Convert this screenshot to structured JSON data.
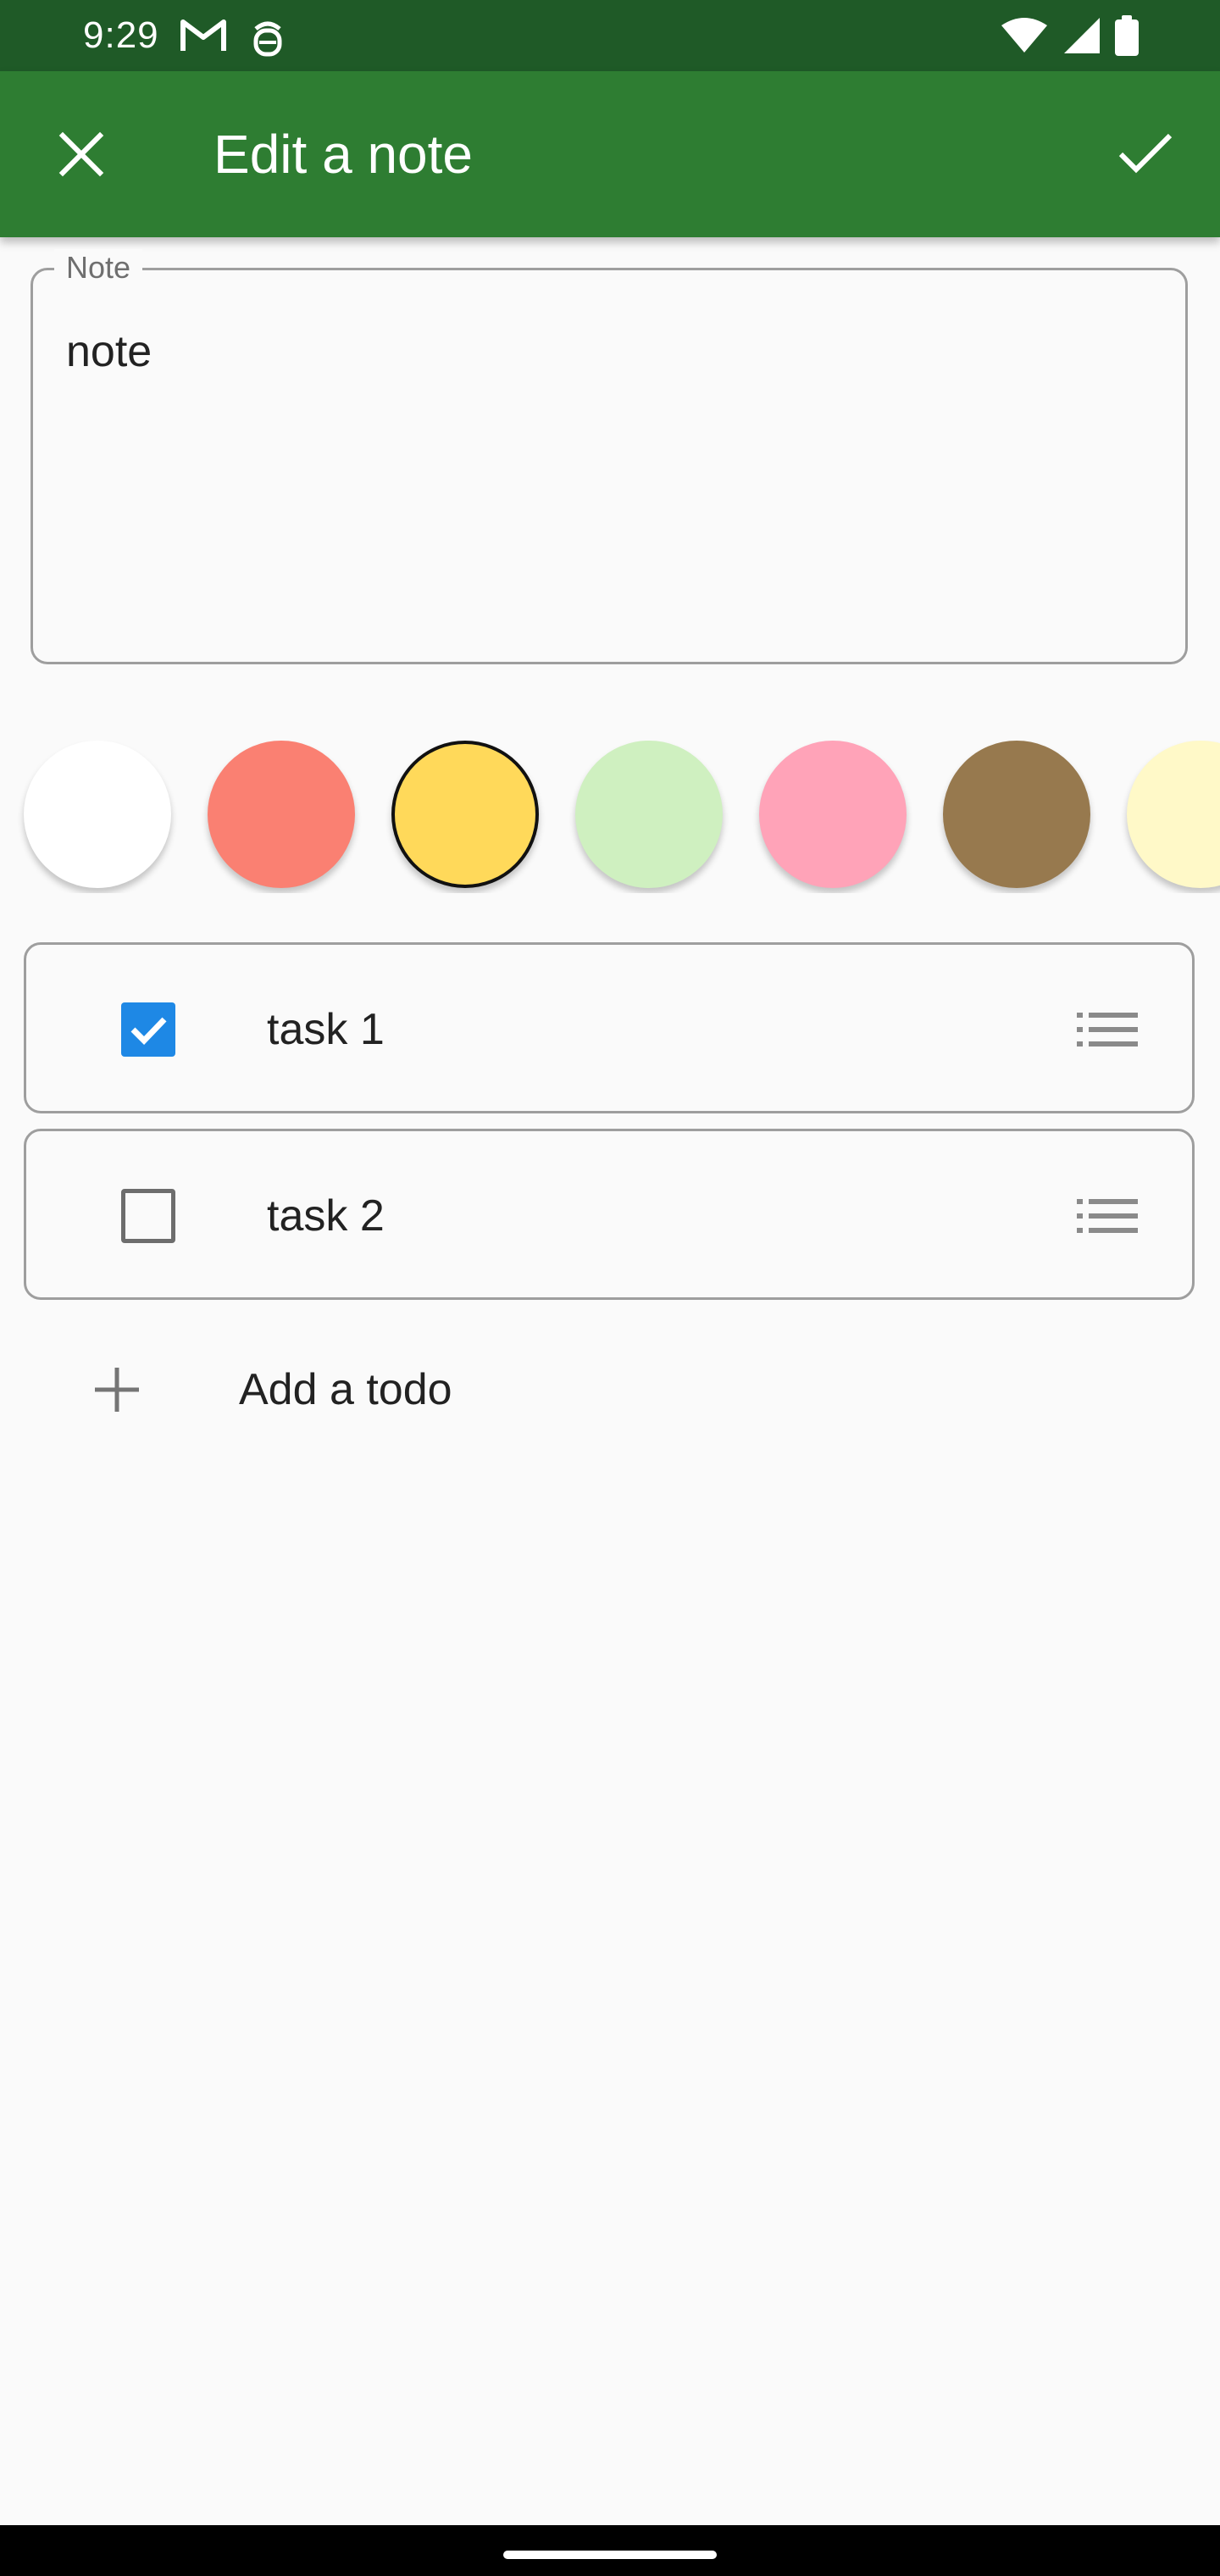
{
  "status_bar": {
    "time": "9:29",
    "left_icons": [
      "gmail-icon",
      "android-debug-icon"
    ],
    "right_icons": [
      "wifi-icon",
      "signal-icon",
      "battery-icon"
    ]
  },
  "app_bar": {
    "title": "Edit a note",
    "close_icon": "close-icon",
    "confirm_icon": "check-icon",
    "background": "#2e7d32",
    "status_background": "#1f5a27"
  },
  "note": {
    "label": "Note",
    "value": "note"
  },
  "colors": {
    "options": [
      "#ffffff",
      "#fa8072",
      "#ffd95a",
      "#cff0c0",
      "#ffa3b8",
      "#97794e",
      "#fff9c8"
    ],
    "selected_index": 2
  },
  "todos": [
    {
      "label": "task 1",
      "checked": true,
      "handle_icon": "drag-handle-icon"
    },
    {
      "label": "task 2",
      "checked": false,
      "handle_icon": "drag-handle-icon"
    }
  ],
  "add_todo": {
    "label": "Add a todo",
    "icon": "plus-icon"
  },
  "theme": {
    "checkbox_checked": "#1e88e5"
  }
}
